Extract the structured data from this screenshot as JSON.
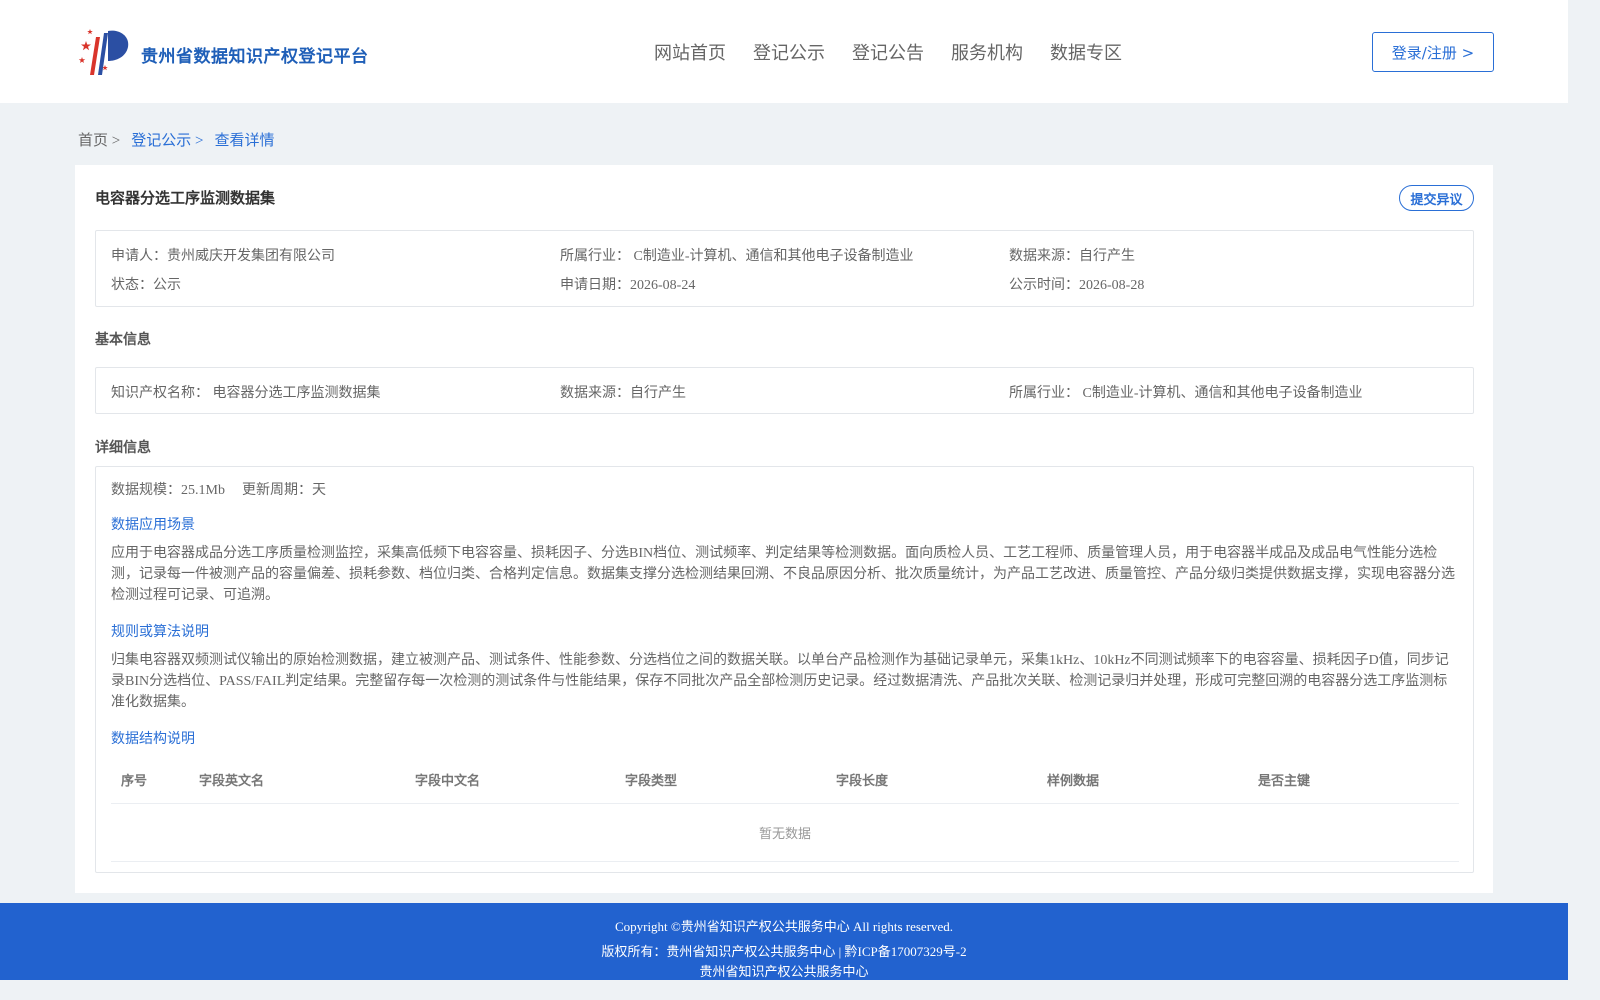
{
  "header": {
    "site_title": "贵州省数据知识产权登记平台",
    "nav": [
      "网站首页",
      "登记公示",
      "登记公告",
      "服务机构",
      "数据专区"
    ],
    "login_label": "登录/注册 >"
  },
  "breadcrumb": {
    "home": "首页 >",
    "section": "登记公示 >",
    "current": "查看详情"
  },
  "dataset": {
    "title": "电容器分选工序监测数据集",
    "objection_label": "提交异议"
  },
  "summary": {
    "applicant": "申请人：贵州威庆开发集团有限公司",
    "industry": "所属行业： C制造业-计算机、通信和其他电子设备制造业",
    "source": "数据来源：自行产生",
    "status": "状态：公示",
    "apply_date": "申请日期：2026-08-24",
    "publish_time": "公示时间：2026-08-28"
  },
  "basic_info": {
    "heading": "基本信息",
    "ip_name": "知识产权名称： 电容器分选工序监测数据集",
    "source": "数据来源：自行产生",
    "industry": "所属行业： C制造业-计算机、通信和其他电子设备制造业"
  },
  "detail_info": {
    "heading": "详细信息",
    "scale": "数据规模：25.1Mb",
    "update_cycle": "更新周期：天",
    "scene_title": "数据应用场景",
    "scene_text": "应用于电容器成品分选工序质量检测监控，采集高低频下电容容量、损耗因子、分选BIN档位、测试频率、判定结果等检测数据。面向质检人员、工艺工程师、质量管理人员，用于电容器半成品及成品电气性能分选检测，记录每一件被测产品的容量偏差、损耗参数、档位归类、合格判定信息。数据集支撑分选检测结果回溯、不良品原因分析、批次质量统计，为产品工艺改进、质量管控、产品分级归类提供数据支撑，实现电容器分选检测过程可记录、可追溯。",
    "rule_title": "规则或算法说明",
    "rule_text": "归集电容器双频测试仪输出的原始检测数据，建立被测产品、测试条件、性能参数、分选档位之间的数据关联。以单台产品检测作为基础记录单元，采集1kHz、10kHz不同测试频率下的电容容量、损耗因子D值，同步记录BIN分选档位、PASS/FAIL判定结果。完整留存每一次检测的测试条件与性能结果，保存不同批次产品全部检测历史记录。经过数据清洗、产品批次关联、检测记录归并处理，形成可完整回溯的电容器分选工序监测标准化数据集。",
    "struct_title": "数据结构说明",
    "table_headers": [
      "序号",
      "字段英文名",
      "字段中文名",
      "字段类型",
      "字段长度",
      "样例数据",
      "是否主键"
    ],
    "empty_text": "暂无数据"
  },
  "footer": {
    "copyright": "Copyright ©贵州省知识产权公共服务中心 All rights reserved.",
    "rights": "版权所有：贵州省知识产权公共服务中心 | 黔ICP备17007329号-2",
    "org": "贵州省知识产权公共服务中心"
  },
  "colors": {
    "accent": "#2a6fd6",
    "footer": "#2262cf",
    "logo_red": "#d9342b",
    "logo_blue": "#2b4fa3"
  }
}
